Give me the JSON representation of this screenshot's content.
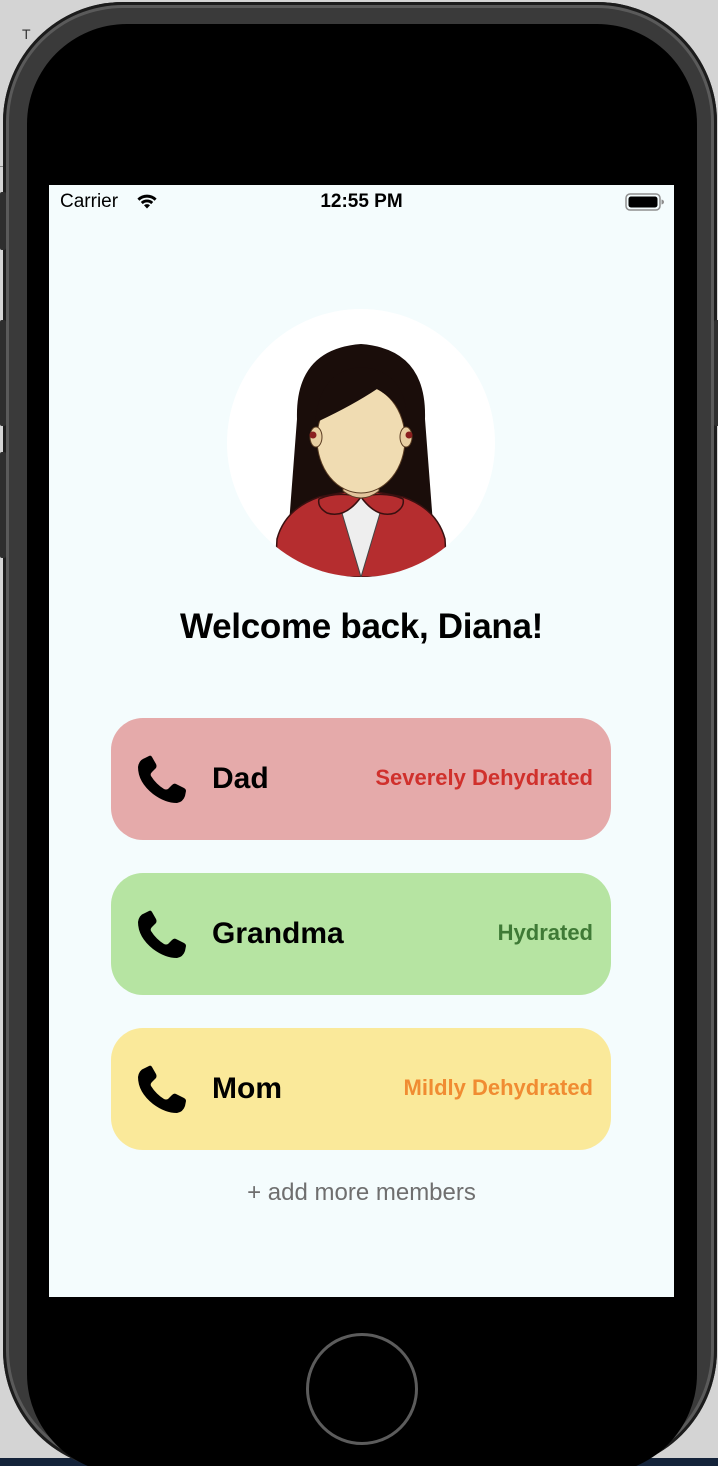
{
  "backdrop": {
    "letter": "T"
  },
  "status_bar": {
    "carrier": "Carrier",
    "time": "12:55 PM",
    "wifi_icon": "wifi-icon",
    "battery_icon": "battery-icon"
  },
  "profile": {
    "avatar_icon": "woman-avatar-icon",
    "welcome": "Welcome back, Diana!"
  },
  "members": [
    {
      "name": "Dad",
      "status": "Severely Dehydrated",
      "card_color": "#e5aaaa",
      "status_color": "#d0302c",
      "icon": "phone-icon"
    },
    {
      "name": "Grandma",
      "status": "Hydrated",
      "card_color": "#b6e4a2",
      "status_color": "#3f7a36",
      "icon": "phone-icon"
    },
    {
      "name": "Mom",
      "status": "Mildly Dehydrated",
      "card_color": "#fae99a",
      "status_color": "#f08c32",
      "icon": "phone-icon"
    }
  ],
  "add_members_label": "+ add more members",
  "colors": {
    "screen_background": "#f4fcfd",
    "text": "#000000",
    "muted_text": "#6f6f6f"
  }
}
